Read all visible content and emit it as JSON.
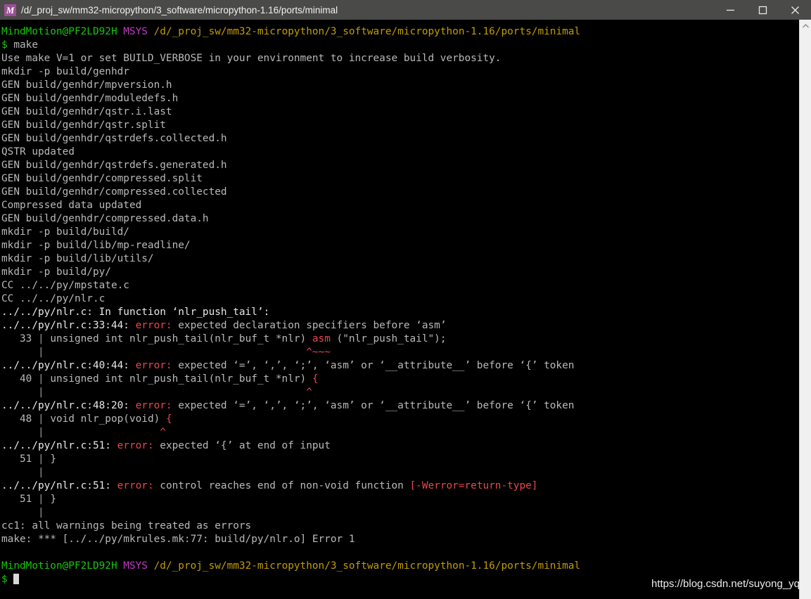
{
  "window": {
    "title": "/d/_proj_sw/mm32-micropython/3_software/micropython-1.16/ports/minimal",
    "icon_letter": "M",
    "icon_color": "#9b4f96",
    "titlebar_color": "#4a4a48",
    "controls": {
      "minimize": "Minimize",
      "maximize": "Maximize",
      "close": "Close"
    }
  },
  "colors": {
    "background": "#000000",
    "foreground": "#cccccc",
    "green": "#16c60c",
    "magenta": "#c03ac0",
    "yellow": "#c19c00",
    "red": "#e5484d",
    "white": "#e8e8e8"
  },
  "prompt": {
    "user_host": "MindMotion@PF2LD92H",
    "shell": "MSYS",
    "path": "/d/_proj_sw/mm32-micropython/3_software/micropython-1.16/ports/minimal",
    "symbol": "$",
    "command": "make"
  },
  "terminal": {
    "lines": [
      {
        "id": "prompt-1",
        "segs": [
          {
            "t": "MindMotion@PF2LD92H",
            "c": "c-green"
          },
          {
            "t": " ",
            "c": ""
          },
          {
            "t": "MSYS",
            "c": "c-magenta"
          },
          {
            "t": " ",
            "c": ""
          },
          {
            "t": "/d/_proj_sw/mm32-micropython/3_software/micropython-1.16/ports/minimal",
            "c": "c-yellow"
          }
        ]
      },
      {
        "id": "cmd-make",
        "segs": [
          {
            "t": "$",
            "c": "c-green"
          },
          {
            "t": " make",
            "c": "c-grey"
          }
        ]
      },
      {
        "id": "verbose-hint",
        "segs": [
          {
            "t": "Use make V=1 or set BUILD_VERBOSE in your environment to increase build verbosity.",
            "c": "c-grey"
          }
        ]
      },
      {
        "id": "mkdir-genhdr",
        "segs": [
          {
            "t": "mkdir -p build/genhdr",
            "c": "c-grey"
          }
        ]
      },
      {
        "id": "gen-mpversion",
        "segs": [
          {
            "t": "GEN build/genhdr/mpversion.h",
            "c": "c-grey"
          }
        ]
      },
      {
        "id": "gen-moduledefs",
        "segs": [
          {
            "t": "GEN build/genhdr/moduledefs.h",
            "c": "c-grey"
          }
        ]
      },
      {
        "id": "gen-qstr-i-last",
        "segs": [
          {
            "t": "GEN build/genhdr/qstr.i.last",
            "c": "c-grey"
          }
        ]
      },
      {
        "id": "gen-qstr-split",
        "segs": [
          {
            "t": "GEN build/genhdr/qstr.split",
            "c": "c-grey"
          }
        ]
      },
      {
        "id": "gen-qstrdefs-collected",
        "segs": [
          {
            "t": "GEN build/genhdr/qstrdefs.collected.h",
            "c": "c-grey"
          }
        ]
      },
      {
        "id": "qstr-updated",
        "segs": [
          {
            "t": "QSTR updated",
            "c": "c-grey"
          }
        ]
      },
      {
        "id": "gen-qstrdefs-generated",
        "segs": [
          {
            "t": "GEN build/genhdr/qstrdefs.generated.h",
            "c": "c-grey"
          }
        ]
      },
      {
        "id": "gen-compressed-split",
        "segs": [
          {
            "t": "GEN build/genhdr/compressed.split",
            "c": "c-grey"
          }
        ]
      },
      {
        "id": "gen-compressed-collected",
        "segs": [
          {
            "t": "GEN build/genhdr/compressed.collected",
            "c": "c-grey"
          }
        ]
      },
      {
        "id": "compressed-updated",
        "segs": [
          {
            "t": "Compressed data updated",
            "c": "c-grey"
          }
        ]
      },
      {
        "id": "gen-compressed-data",
        "segs": [
          {
            "t": "GEN build/genhdr/compressed.data.h",
            "c": "c-grey"
          }
        ]
      },
      {
        "id": "mkdir-build",
        "segs": [
          {
            "t": "mkdir -p build/build/",
            "c": "c-grey"
          }
        ]
      },
      {
        "id": "mkdir-mp-readline",
        "segs": [
          {
            "t": "mkdir -p build/lib/mp-readline/",
            "c": "c-grey"
          }
        ]
      },
      {
        "id": "mkdir-utils",
        "segs": [
          {
            "t": "mkdir -p build/lib/utils/",
            "c": "c-grey"
          }
        ]
      },
      {
        "id": "mkdir-py",
        "segs": [
          {
            "t": "mkdir -p build/py/",
            "c": "c-grey"
          }
        ]
      },
      {
        "id": "cc-mpstate",
        "segs": [
          {
            "t": "CC ../../py/mpstate.c",
            "c": "c-grey"
          }
        ]
      },
      {
        "id": "cc-nlr",
        "segs": [
          {
            "t": "CC ../../py/nlr.c",
            "c": "c-grey"
          }
        ]
      },
      {
        "id": "in-function",
        "segs": [
          {
            "t": "../../py/nlr.c: In function ",
            "c": "c-white"
          },
          {
            "t": "‘nlr_push_tail’",
            "c": "c-white"
          },
          {
            "t": ":",
            "c": "c-white"
          }
        ]
      },
      {
        "id": "error-33-44",
        "segs": [
          {
            "t": "../../py/nlr.c:33:44: ",
            "c": "c-white"
          },
          {
            "t": "error: ",
            "c": "c-red"
          },
          {
            "t": "expected declaration specifiers before ‘asm’",
            "c": "c-grey"
          }
        ]
      },
      {
        "id": "src-33",
        "segs": [
          {
            "t": "   33 ",
            "c": "c-grey"
          },
          {
            "t": "|",
            "c": "c-dim"
          },
          {
            "t": " unsigned int nlr_push_tail(nlr_buf_t *nlr) ",
            "c": "c-grey"
          },
          {
            "t": "asm",
            "c": "c-red"
          },
          {
            "t": " (\"nlr_push_tail\");",
            "c": "c-grey"
          }
        ]
      },
      {
        "id": "caret-33",
        "segs": [
          {
            "t": "      ",
            "c": ""
          },
          {
            "t": "|",
            "c": "c-dim"
          },
          {
            "t": "                                           ",
            "c": ""
          },
          {
            "t": "^~~~",
            "c": "c-red"
          }
        ]
      },
      {
        "id": "error-40-44",
        "segs": [
          {
            "t": "../../py/nlr.c:40:44: ",
            "c": "c-white"
          },
          {
            "t": "error: ",
            "c": "c-red"
          },
          {
            "t": "expected ‘=’, ‘,’, ‘;’, ‘asm’ or ‘__attribute__’ before ‘{’ token",
            "c": "c-grey"
          }
        ]
      },
      {
        "id": "src-40",
        "segs": [
          {
            "t": "   40 ",
            "c": "c-grey"
          },
          {
            "t": "|",
            "c": "c-dim"
          },
          {
            "t": " unsigned int nlr_push_tail(nlr_buf_t *nlr) ",
            "c": "c-grey"
          },
          {
            "t": "{",
            "c": "c-red"
          }
        ]
      },
      {
        "id": "caret-40",
        "segs": [
          {
            "t": "      ",
            "c": ""
          },
          {
            "t": "|",
            "c": "c-dim"
          },
          {
            "t": "                                           ",
            "c": ""
          },
          {
            "t": "^",
            "c": "c-red"
          }
        ]
      },
      {
        "id": "error-48-20",
        "segs": [
          {
            "t": "../../py/nlr.c:48:20: ",
            "c": "c-white"
          },
          {
            "t": "error: ",
            "c": "c-red"
          },
          {
            "t": "expected ‘=’, ‘,’, ‘;’, ‘asm’ or ‘__attribute__’ before ‘{’ token",
            "c": "c-grey"
          }
        ]
      },
      {
        "id": "src-48",
        "segs": [
          {
            "t": "   48 ",
            "c": "c-grey"
          },
          {
            "t": "|",
            "c": "c-dim"
          },
          {
            "t": " void nlr_pop(void) ",
            "c": "c-grey"
          },
          {
            "t": "{",
            "c": "c-red"
          }
        ]
      },
      {
        "id": "caret-48",
        "segs": [
          {
            "t": "      ",
            "c": ""
          },
          {
            "t": "|",
            "c": "c-dim"
          },
          {
            "t": "                   ",
            "c": ""
          },
          {
            "t": "^",
            "c": "c-red"
          }
        ]
      },
      {
        "id": "error-51-brace",
        "segs": [
          {
            "t": "../../py/nlr.c:51: ",
            "c": "c-white"
          },
          {
            "t": "error: ",
            "c": "c-red"
          },
          {
            "t": "expected ‘{’ at end of input",
            "c": "c-grey"
          }
        ]
      },
      {
        "id": "src-51-a",
        "segs": [
          {
            "t": "   51 ",
            "c": "c-grey"
          },
          {
            "t": "|",
            "c": "c-dim"
          },
          {
            "t": " }",
            "c": "c-grey"
          }
        ]
      },
      {
        "id": "caret-51-a",
        "segs": [
          {
            "t": "      ",
            "c": ""
          },
          {
            "t": "|",
            "c": "c-dim"
          }
        ]
      },
      {
        "id": "error-51-return",
        "segs": [
          {
            "t": "../../py/nlr.c:51: ",
            "c": "c-white"
          },
          {
            "t": "error: ",
            "c": "c-red"
          },
          {
            "t": "control reaches end of non-void function ",
            "c": "c-grey"
          },
          {
            "t": "[-Werror=return-type]",
            "c": "c-red"
          }
        ]
      },
      {
        "id": "src-51-b",
        "segs": [
          {
            "t": "   51 ",
            "c": "c-grey"
          },
          {
            "t": "|",
            "c": "c-dim"
          },
          {
            "t": " }",
            "c": "c-grey"
          }
        ]
      },
      {
        "id": "caret-51-b",
        "segs": [
          {
            "t": "      ",
            "c": ""
          },
          {
            "t": "|",
            "c": "c-dim"
          }
        ]
      },
      {
        "id": "cc1-warnings",
        "segs": [
          {
            "t": "cc1: all warnings being treated as errors",
            "c": "c-grey"
          }
        ]
      },
      {
        "id": "make-error",
        "segs": [
          {
            "t": "make: *** [../../py/mkrules.mk:77: build/py/nlr.o] Error 1",
            "c": "c-grey"
          }
        ]
      },
      {
        "id": "blank-1",
        "segs": [
          {
            "t": " ",
            "c": ""
          }
        ]
      },
      {
        "id": "prompt-2",
        "segs": [
          {
            "t": "MindMotion@PF2LD92H",
            "c": "c-green"
          },
          {
            "t": " ",
            "c": ""
          },
          {
            "t": "MSYS",
            "c": "c-magenta"
          },
          {
            "t": " ",
            "c": ""
          },
          {
            "t": "/d/_proj_sw/mm32-micropython/3_software/micropython-1.16/ports/minimal",
            "c": "c-yellow"
          }
        ]
      },
      {
        "id": "prompt-2-input",
        "segs": [
          {
            "t": "$",
            "c": "c-green"
          },
          {
            "t": " ",
            "c": ""
          }
        ],
        "cursor": true
      }
    ]
  },
  "scrollbar": {
    "up_arrow": "scroll-up",
    "track_color": "#f0f0f0"
  },
  "watermark": {
    "text": "https://blog.csdn.net/suyong_yq"
  }
}
